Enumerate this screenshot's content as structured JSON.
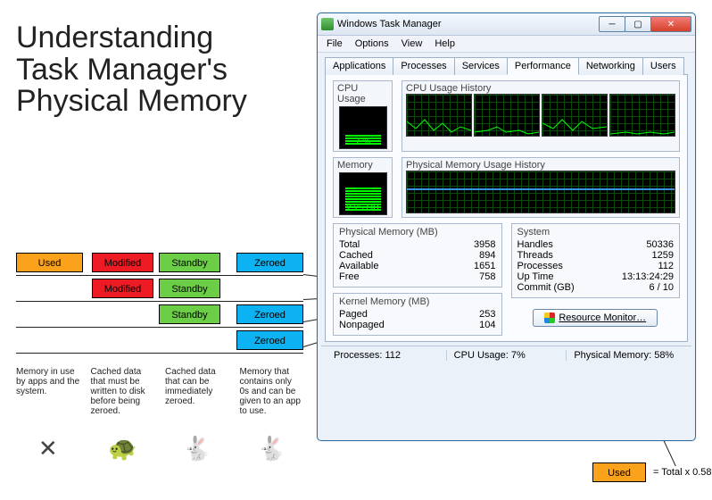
{
  "heading": {
    "line1": "Understanding",
    "line2": "Task Manager's",
    "line3": "Physical Memory"
  },
  "legend": {
    "used": "Used",
    "modified": "Modified",
    "standby": "Standby",
    "zeroed": "Zeroed",
    "desc_used": "Memory in use by apps and the system.",
    "desc_modified": "Cached data that must be written to disk before being zeroed.",
    "desc_standby": "Cached data that can be immediately zeroed.",
    "desc_zeroed": "Memory that contains only 0s and can be given to an app to use.",
    "icon_used": "✕",
    "icon_modified": "🐢",
    "icon_standby": "🐇",
    "icon_zeroed": "🐇"
  },
  "window": {
    "title": "Windows Task Manager",
    "menu": {
      "file": "File",
      "options": "Options",
      "view": "View",
      "help": "Help"
    },
    "tabs": {
      "applications": "Applications",
      "processes": "Processes",
      "services": "Services",
      "performance": "Performance",
      "networking": "Networking",
      "users": "Users"
    },
    "cpu_usage_label": "CPU Usage",
    "cpu_usage_value": "7 %",
    "cpu_history_label": "CPU Usage History",
    "memory_label": "Memory",
    "memory_value": "2.25 GB",
    "mem_history_label": "Physical Memory Usage History",
    "phys_mem": {
      "title": "Physical Memory (MB)",
      "total_label": "Total",
      "total": "3958",
      "cached_label": "Cached",
      "cached": "894",
      "available_label": "Available",
      "available": "1651",
      "free_label": "Free",
      "free": "758"
    },
    "kernel_mem": {
      "title": "Kernel Memory (MB)",
      "paged_label": "Paged",
      "paged": "253",
      "nonpaged_label": "Nonpaged",
      "nonpaged": "104"
    },
    "system": {
      "title": "System",
      "handles_label": "Handles",
      "handles": "50336",
      "threads_label": "Threads",
      "threads": "1259",
      "processes_label": "Processes",
      "processes": "112",
      "uptime_label": "Up Time",
      "uptime": "13:13:24:29",
      "commit_label": "Commit (GB)",
      "commit": "6 / 10"
    },
    "resource_monitor_btn": "Resource Monitor…",
    "status": {
      "processes": "Processes: 112",
      "cpu": "CPU Usage: 7%",
      "memory": "Physical Memory: 58%"
    }
  },
  "annotation": {
    "used": "Used",
    "formula": "= Total x 0.58"
  }
}
